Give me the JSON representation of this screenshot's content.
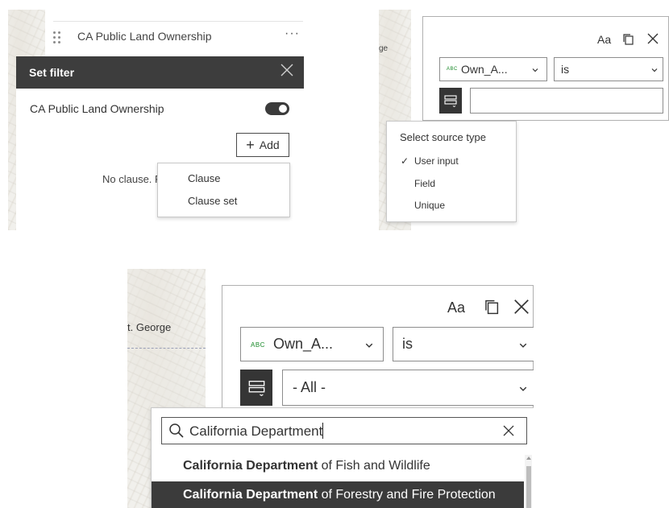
{
  "panel_a": {
    "layer_title": "CA Public Land Ownership",
    "more_label": "···",
    "set_filter_title": "Set filter",
    "filter_layer_name": "CA Public Land Ownership",
    "add_button_label": "Add",
    "add_button_icon": "plus-icon",
    "no_clause_text": "No clause. Pl",
    "add_menu": [
      "Clause",
      "Clause set"
    ]
  },
  "panel_b": {
    "map_label": "ge",
    "aa_label": "Aa",
    "field_value": "Own_A...",
    "field_type_badge": "ABC",
    "operator_value": "is",
    "value_input": "",
    "source_menu": {
      "header": "Select source type",
      "check_mark": "✓",
      "options": [
        "User input",
        "Field",
        "Unique"
      ],
      "selected": "User input"
    }
  },
  "panel_c": {
    "map_label": "t. George",
    "aa_label": "Aa",
    "field_value": "Own_A...",
    "field_type_badge": "ABC",
    "operator_value": "is",
    "value_select": "- All -",
    "search_query": "California Department",
    "results": [
      {
        "match": "California Department",
        "rest": " of Fish and Wildlife",
        "selected": false
      },
      {
        "match": "California Department",
        "rest": " of Forestry and Fire Protection",
        "selected": true
      }
    ]
  },
  "colors": {
    "dark_header": "#3d3d3d",
    "selected_row": "#3b3b3b",
    "abc_badge": "#1a8a2a",
    "map_base": "#efeee9"
  }
}
